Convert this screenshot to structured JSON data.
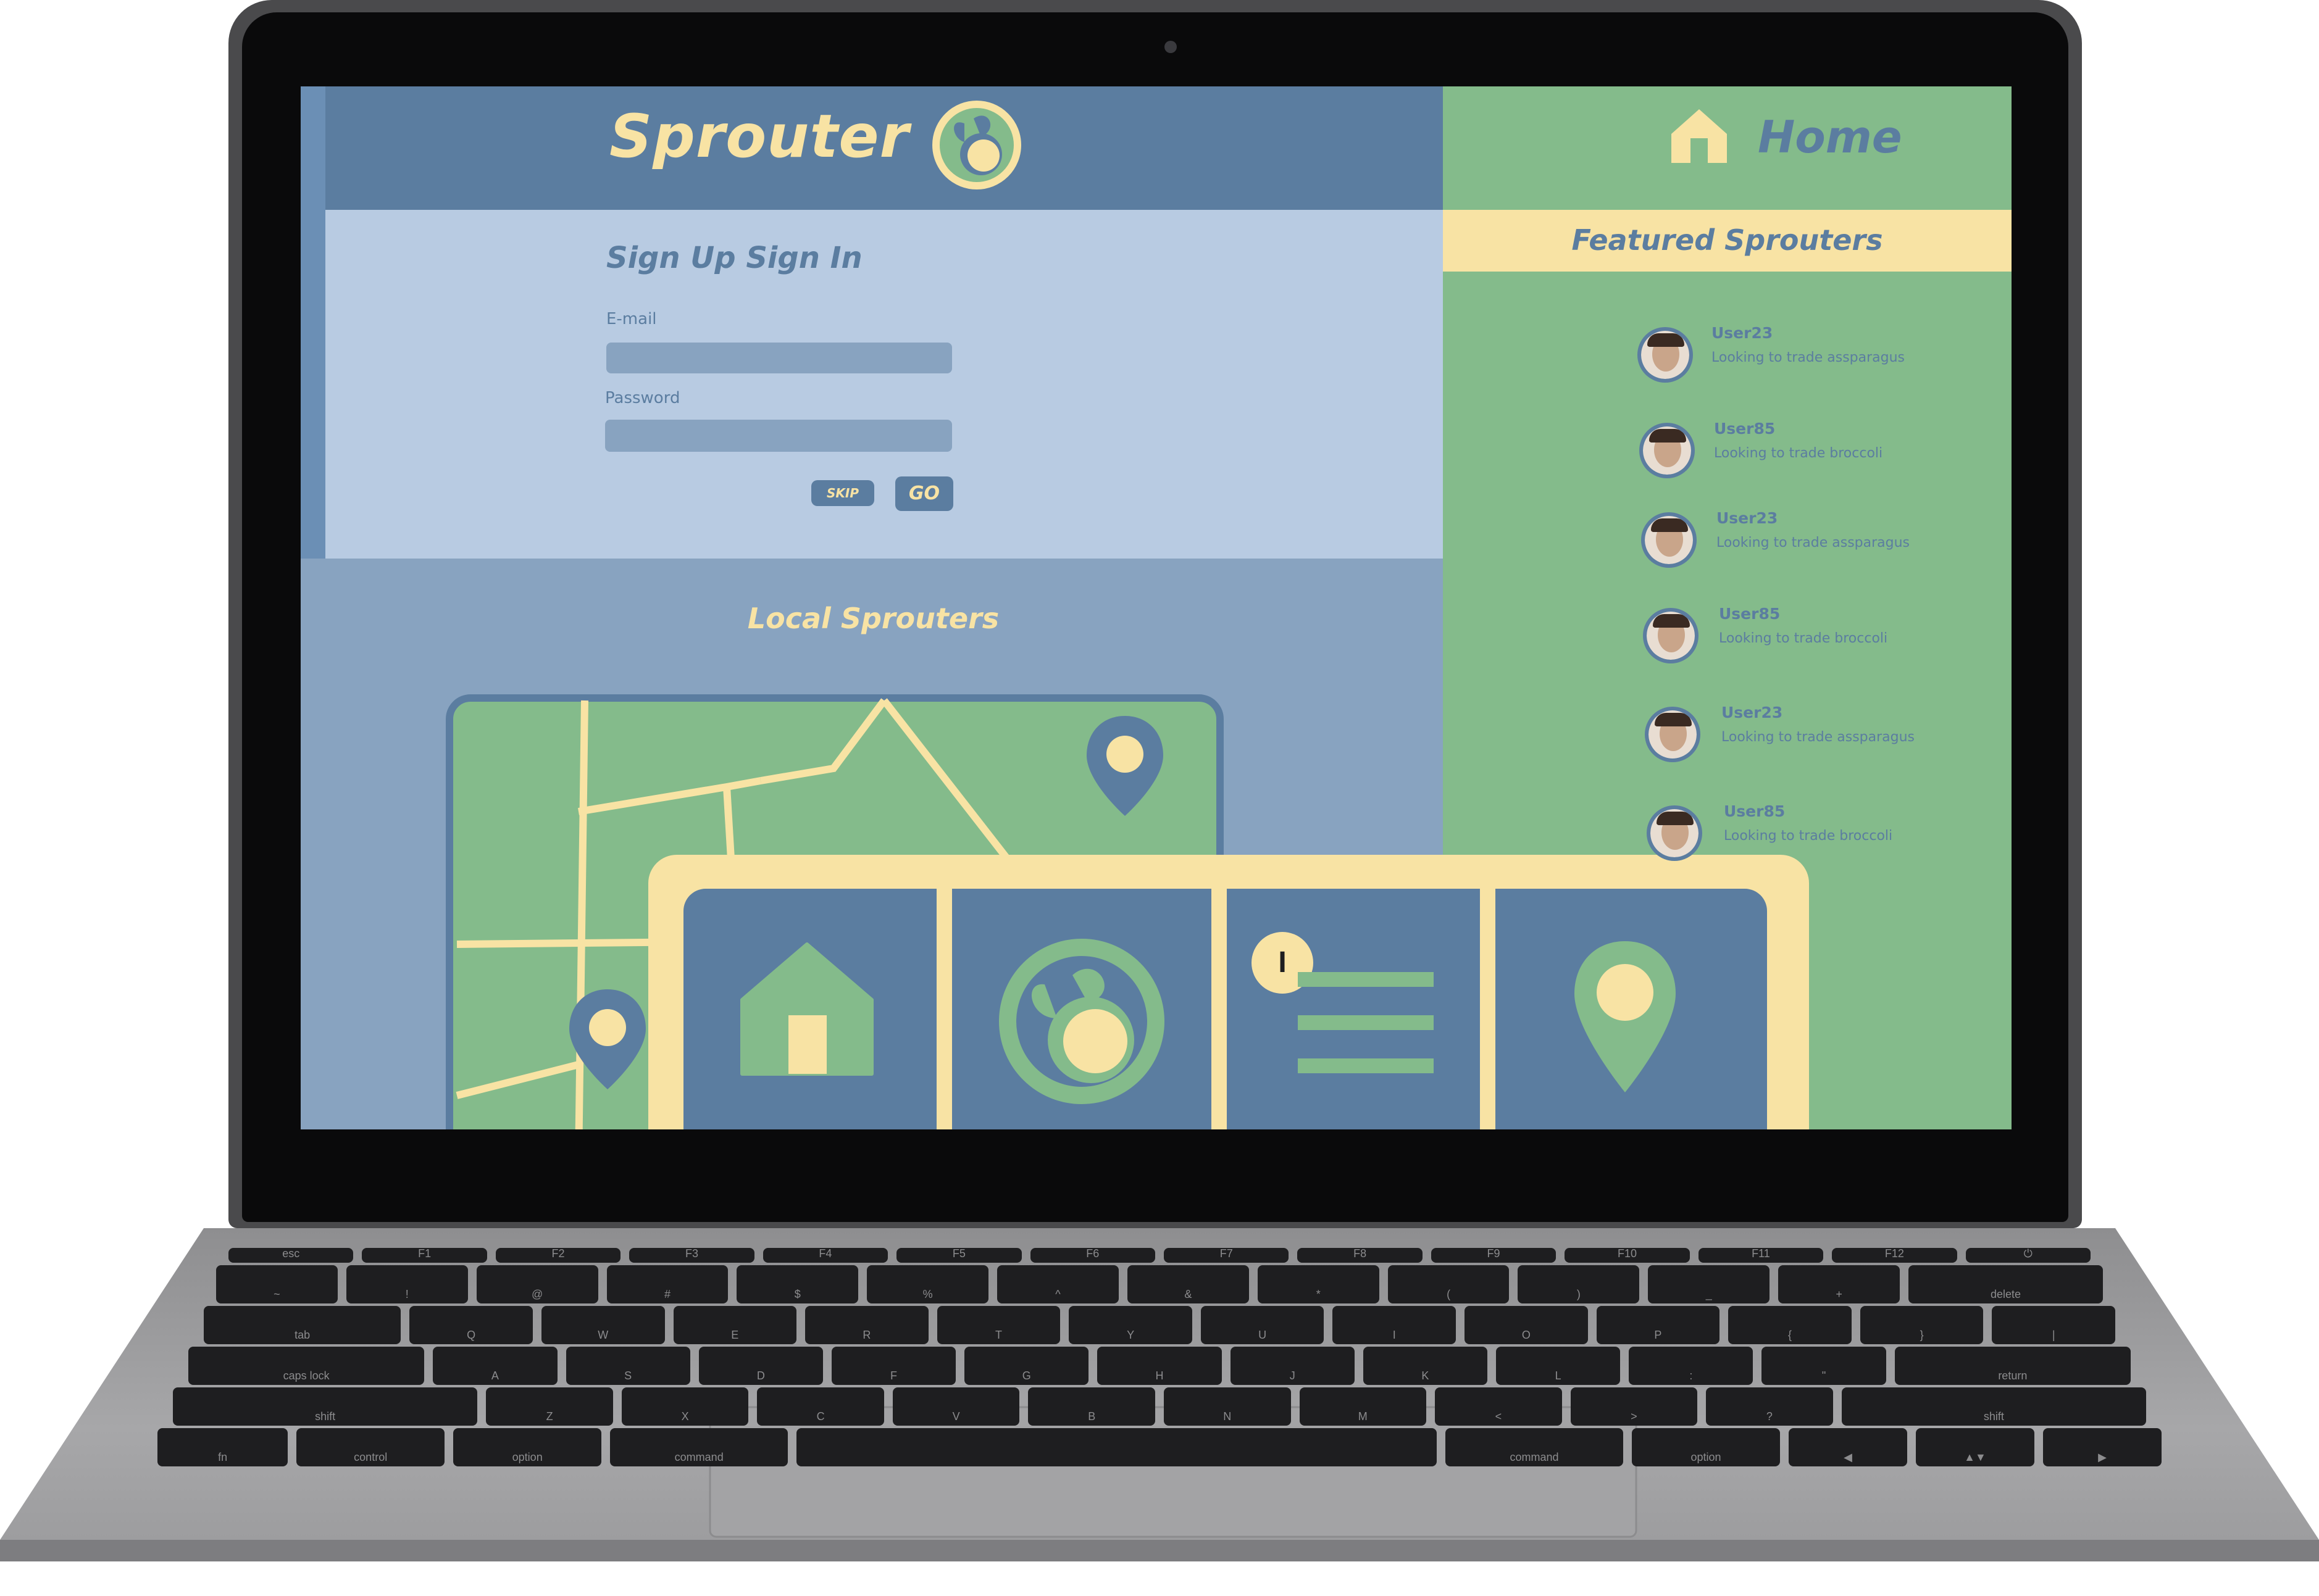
{
  "app": {
    "logo_text": "Sprouter",
    "page_title": "Home"
  },
  "signin": {
    "heading": "Sign Up Sign In",
    "email_label": "E-mail",
    "email_value": "",
    "password_label": "Password",
    "password_value": "",
    "skip_label": "SKIP",
    "go_label": "GO"
  },
  "local": {
    "heading": "Local Sprouters"
  },
  "featured": {
    "heading": "Featured Sprouters",
    "users": [
      {
        "name": "User23",
        "desc": "Looking to trade assparagus"
      },
      {
        "name": "User85",
        "desc": "Looking to trade broccoli"
      },
      {
        "name": "User23",
        "desc": "Looking to trade assparagus"
      },
      {
        "name": "User85",
        "desc": "Looking to trade broccoli"
      },
      {
        "name": "User23",
        "desc": "Looking to trade assparagus"
      },
      {
        "name": "User85",
        "desc": "Looking to trade broccoli"
      }
    ]
  },
  "nav": {
    "items": [
      {
        "icon": "home-icon"
      },
      {
        "icon": "sprout-logo-icon"
      },
      {
        "icon": "info-list-icon"
      },
      {
        "icon": "location-pin-icon"
      }
    ],
    "info_glyph": "I"
  },
  "keyboard": {
    "row1": [
      "esc",
      "F1",
      "F2",
      "F3",
      "F4",
      "F5",
      "F6",
      "F7",
      "F8",
      "F9",
      "F10",
      "F11",
      "F12",
      "⏻"
    ],
    "row2": [
      "~",
      "!",
      "@",
      "#",
      "$",
      "%",
      "^",
      "&",
      "*",
      "(",
      ")",
      "_",
      "+",
      "delete"
    ],
    "row3": [
      "tab",
      "Q",
      "W",
      "E",
      "R",
      "T",
      "Y",
      "U",
      "I",
      "O",
      "P",
      "{",
      "}",
      "|"
    ],
    "row4": [
      "caps lock",
      "A",
      "S",
      "D",
      "F",
      "G",
      "H",
      "J",
      "K",
      "L",
      ":",
      "\"",
      "return"
    ],
    "row5": [
      "shift",
      "Z",
      "X",
      "C",
      "V",
      "B",
      "N",
      "M",
      "<",
      ">",
      "?",
      "shift"
    ],
    "row6": [
      "fn",
      "control",
      "option",
      "command",
      "",
      "command",
      "option",
      "◀",
      "▲▼",
      "▶"
    ]
  },
  "colors": {
    "blue": "#5b7da0",
    "light_blue": "#b8cbe2",
    "mid_blue": "#88a3c0",
    "green": "#84bb8b",
    "cream": "#f8e3a4"
  }
}
